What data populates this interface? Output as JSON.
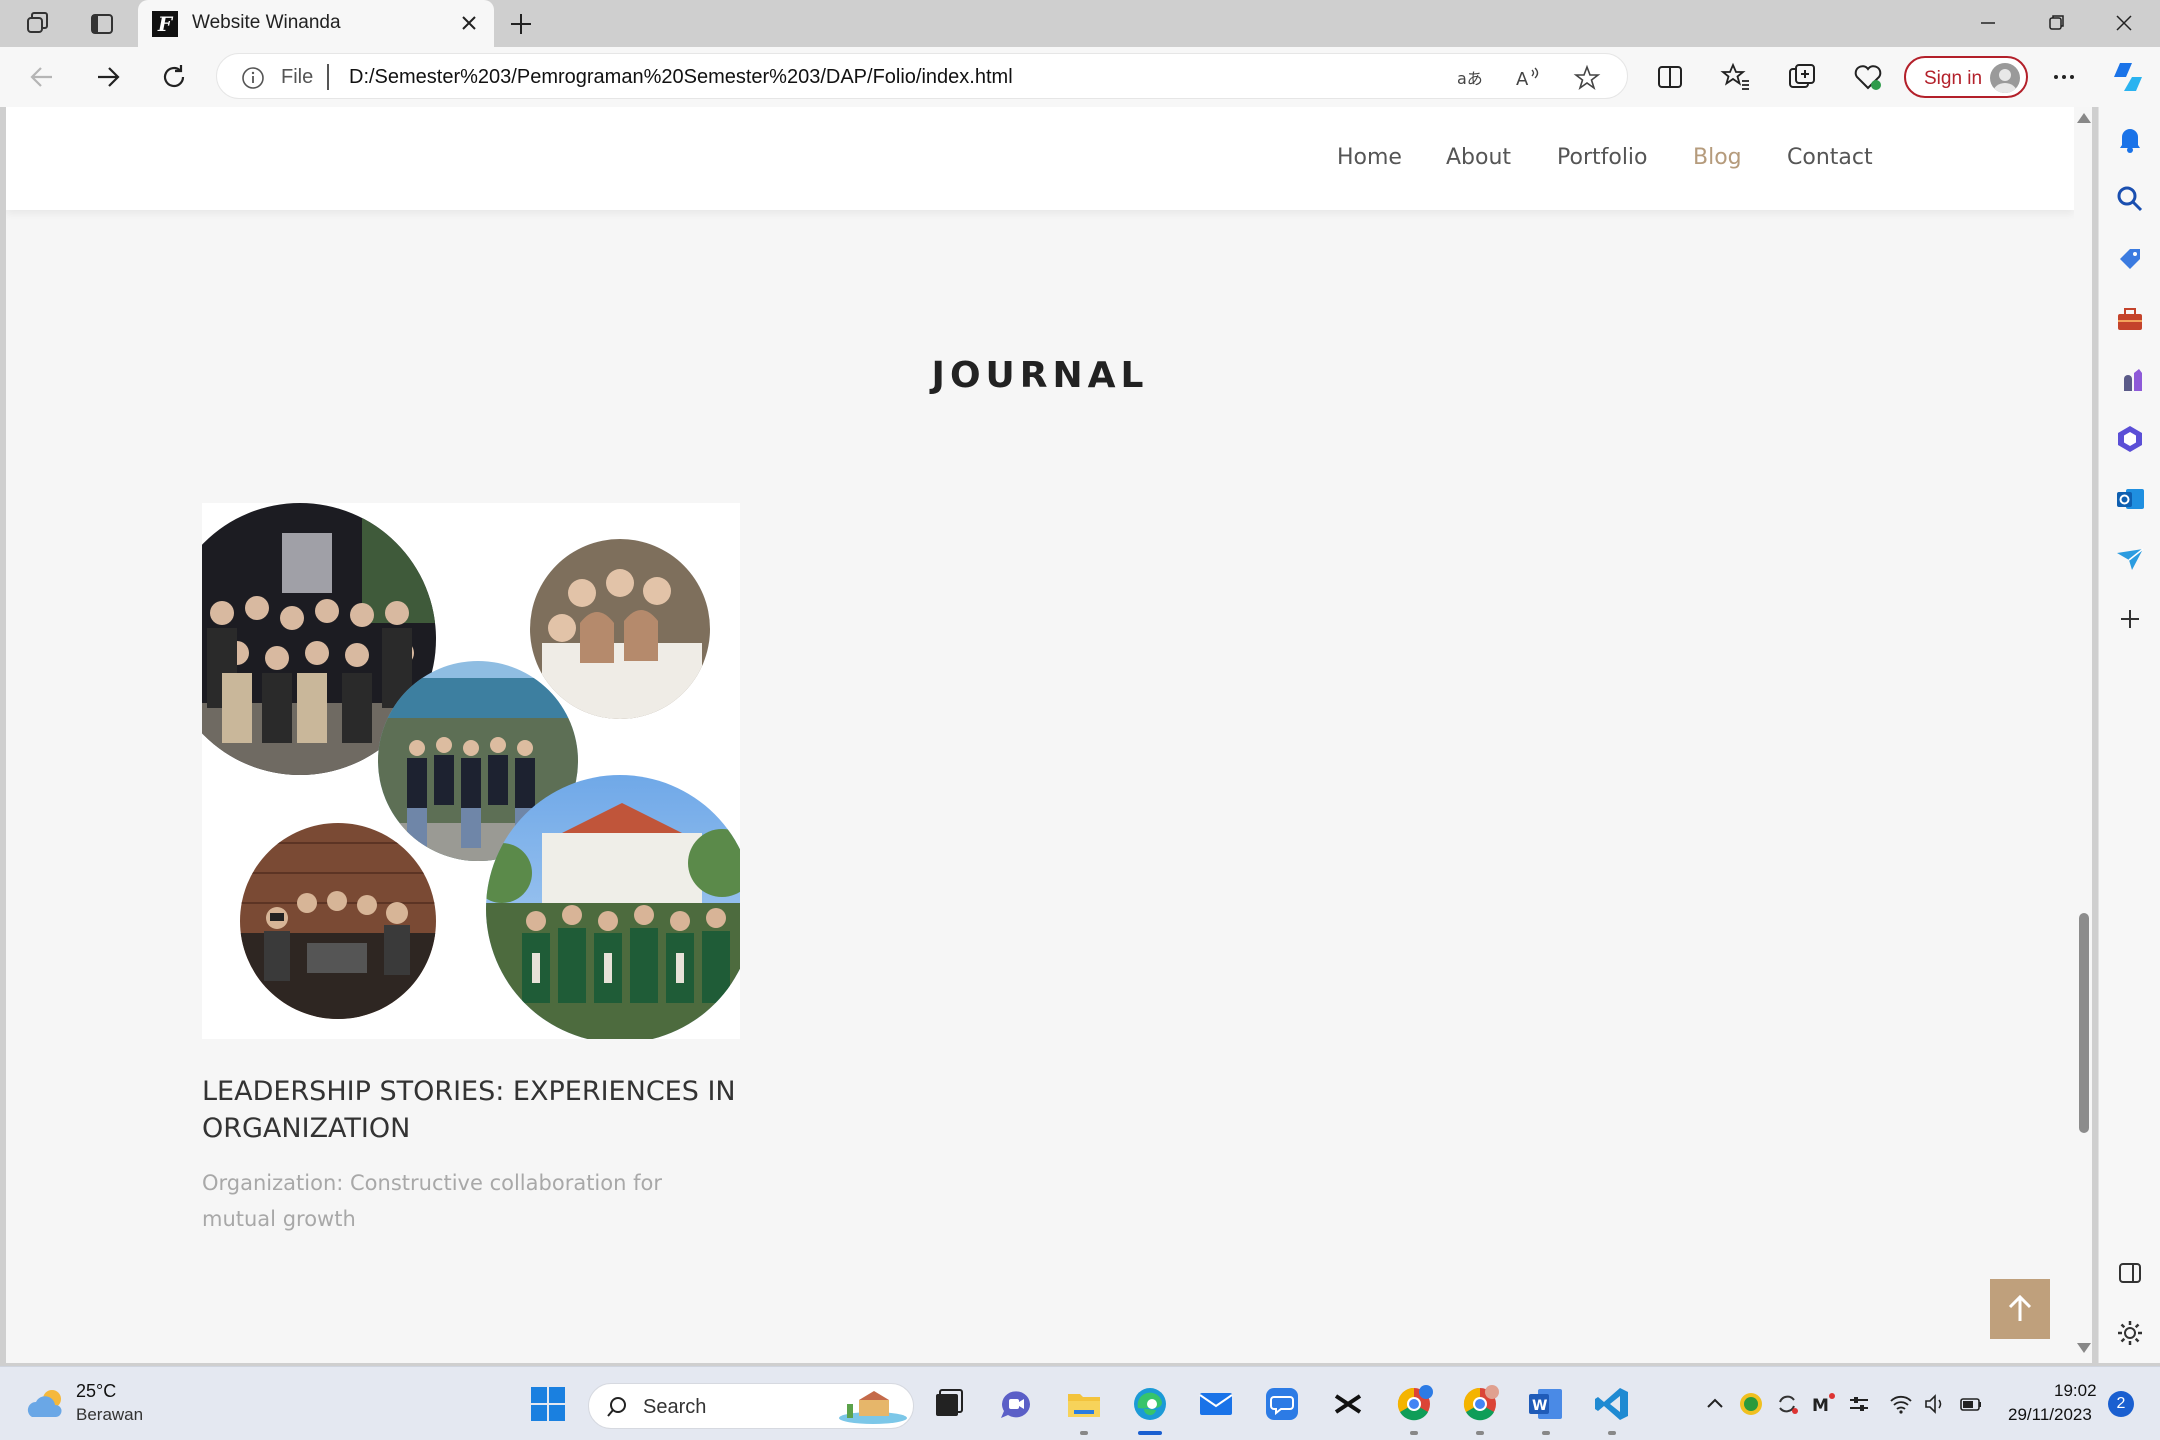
{
  "browser": {
    "tab_title": "Website Winanda",
    "file_label": "File",
    "url": "D:/Semester%203/Pemrograman%20Semester%203/DAP/Folio/index.html",
    "sign_in_label": "Sign in"
  },
  "site": {
    "nav": {
      "home": "Home",
      "about": "About",
      "portfolio": "Portfolio",
      "blog": "Blog",
      "contact": "Contact",
      "active": "Blog"
    },
    "section_title": "JOURNAL",
    "post": {
      "title": "LEADERSHIP STORIES: EXPERIENCES IN ORGANIZATION",
      "excerpt": "Organization: Constructive collaboration for mutual growth"
    },
    "accent_color": "#bfa07c"
  },
  "taskbar": {
    "weather_temp": "25°C",
    "weather_desc": "Berawan",
    "search_label": "Search",
    "time": "19:02",
    "date": "29/11/2023",
    "notification_count": "2"
  }
}
